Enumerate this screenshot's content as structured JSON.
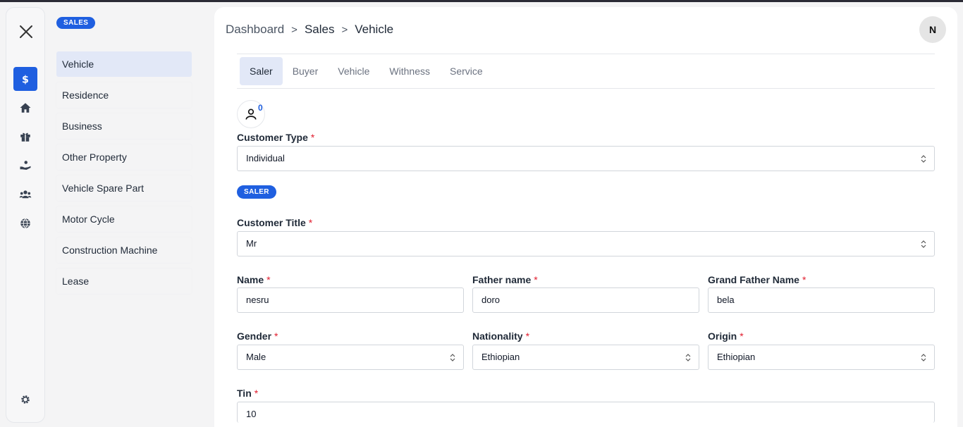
{
  "sidebar_rail": {
    "icons": [
      "close-icon",
      "dollar-icon",
      "home-icon",
      "gift-icon",
      "hand-coin-icon",
      "users-icon",
      "globe-icon",
      "gear-icon"
    ],
    "active": "dollar-icon",
    "accent": "#1f5fe0"
  },
  "subnav": {
    "badge": "SALES",
    "items": [
      {
        "label": "Vehicle",
        "active": true
      },
      {
        "label": "Residence"
      },
      {
        "label": "Business"
      },
      {
        "label": "Other Property"
      },
      {
        "label": "Vehicle Spare Part"
      },
      {
        "label": "Motor Cycle"
      },
      {
        "label": "Construction Machine"
      },
      {
        "label": "Lease"
      }
    ]
  },
  "header": {
    "breadcrumb": [
      "Dashboard",
      "Sales",
      "Vehicle"
    ],
    "separator": ">",
    "avatar_initial": "N"
  },
  "tabs": [
    "Saler",
    "Buyer",
    "Vehicle",
    "Withness",
    "Service"
  ],
  "active_tab": "Saler",
  "person_count": "0",
  "form": {
    "customer_type": {
      "label": "Customer Type",
      "value": "Individual"
    },
    "role_badge": "SALER",
    "customer_title": {
      "label": "Customer Title",
      "value": "Mr"
    },
    "name": {
      "label": "Name",
      "value": "nesru"
    },
    "father_name": {
      "label": "Father name",
      "value": "doro"
    },
    "grand_father_name": {
      "label": "Grand Father Name",
      "value": "bela"
    },
    "gender": {
      "label": "Gender",
      "value": "Male"
    },
    "nationality": {
      "label": "Nationality",
      "value": "Ethiopian"
    },
    "origin": {
      "label": "Origin",
      "value": "Ethiopian"
    },
    "tin": {
      "label": "Tin",
      "value": "10"
    },
    "required_mark": "*"
  }
}
